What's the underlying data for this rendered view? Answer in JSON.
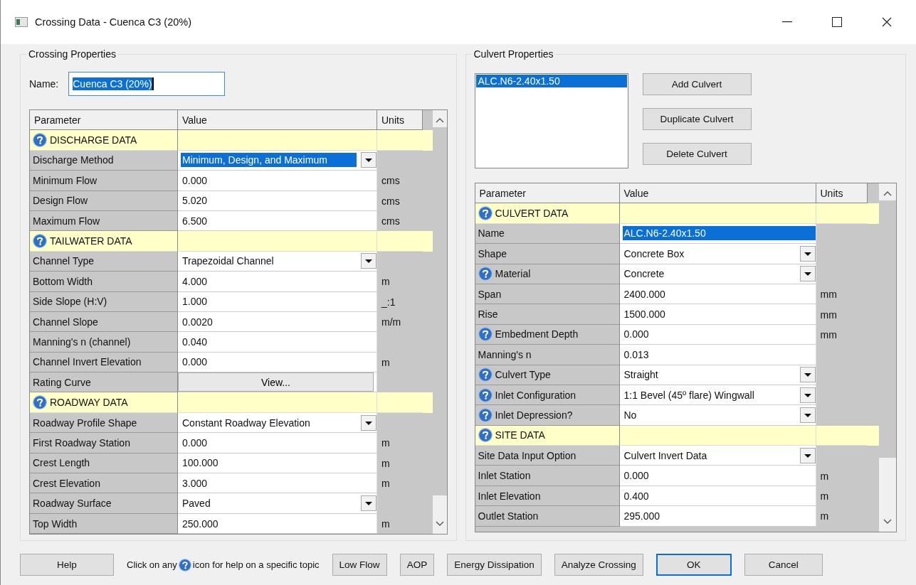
{
  "window": {
    "title": "Crossing Data - Cuenca C3 (20%)"
  },
  "crossing_properties": {
    "title": "Crossing Properties",
    "name_label": "Name:",
    "name_value": "Cuenca C3 (20%)",
    "table": {
      "columns": [
        "Parameter",
        "Value",
        "Units"
      ],
      "rows": [
        {
          "kind": "section",
          "parameter": "DISCHARGE DATA",
          "help": true
        },
        {
          "kind": "dropdown",
          "parameter": "Discharge Method",
          "value": "Minimum, Design, and Maximum",
          "help": false,
          "selected": true
        },
        {
          "kind": "text",
          "parameter": "Minimum Flow",
          "value": "0.000",
          "units": "cms",
          "help": false,
          "selected": false
        },
        {
          "kind": "text",
          "parameter": "Design Flow",
          "value": "5.020",
          "units": "cms",
          "help": false,
          "selected": false
        },
        {
          "kind": "text",
          "parameter": "Maximum Flow",
          "value": "6.500",
          "units": "cms",
          "help": false,
          "selected": false
        },
        {
          "kind": "section",
          "parameter": "TAILWATER DATA",
          "help": true
        },
        {
          "kind": "dropdown",
          "parameter": "Channel Type",
          "value": "Trapezoidal Channel",
          "help": false,
          "selected": false
        },
        {
          "kind": "text",
          "parameter": "Bottom Width",
          "value": "4.000",
          "units": "m",
          "help": false,
          "selected": false
        },
        {
          "kind": "text",
          "parameter": "Side Slope (H:V)",
          "value": "1.000",
          "units": "_:1",
          "help": false,
          "selected": false
        },
        {
          "kind": "text",
          "parameter": "Channel Slope",
          "value": "0.0020",
          "units": "m/m",
          "help": false,
          "selected": false
        },
        {
          "kind": "text",
          "parameter": "Manning's n (channel)",
          "value": "0.040",
          "help": false,
          "selected": false
        },
        {
          "kind": "text",
          "parameter": "Channel Invert Elevation",
          "value": "0.000",
          "units": "m",
          "help": false,
          "selected": false
        },
        {
          "kind": "button",
          "parameter": "Rating Curve",
          "value": "View...",
          "help": false,
          "selected": false
        },
        {
          "kind": "section",
          "parameter": "ROADWAY DATA",
          "help": true
        },
        {
          "kind": "dropdown",
          "parameter": "Roadway Profile Shape",
          "value": "Constant Roadway Elevation",
          "help": false,
          "selected": false
        },
        {
          "kind": "text",
          "parameter": "First Roadway Station",
          "value": "0.000",
          "units": "m",
          "help": false,
          "selected": false
        },
        {
          "kind": "text",
          "parameter": "Crest Length",
          "value": "100.000",
          "units": "m",
          "help": false,
          "selected": false
        },
        {
          "kind": "text",
          "parameter": "Crest Elevation",
          "value": "3.000",
          "units": "m",
          "help": false,
          "selected": false
        },
        {
          "kind": "dropdown",
          "parameter": "Roadway Surface",
          "value": "Paved",
          "help": false,
          "selected": false
        },
        {
          "kind": "text",
          "parameter": "Top Width",
          "value": "250.000",
          "units": "m",
          "help": false,
          "selected": false
        }
      ]
    }
  },
  "culvert_properties": {
    "title": "Culvert Properties",
    "culverts": [
      {
        "label": "ALC.N6-2.40x1.50",
        "selected": true
      }
    ],
    "buttons": [
      "Add Culvert",
      "Duplicate Culvert",
      "Delete Culvert"
    ],
    "table": {
      "columns": [
        "Parameter",
        "Value",
        "Units"
      ],
      "rows": [
        {
          "kind": "section",
          "parameter": "CULVERT DATA",
          "help": true
        },
        {
          "kind": "text",
          "parameter": "Name",
          "value": "ALC.N6-2.40x1.50",
          "help": false,
          "selected": true
        },
        {
          "kind": "dropdown",
          "parameter": "Shape",
          "value": "Concrete Box",
          "help": false,
          "selected": false
        },
        {
          "kind": "dropdown",
          "parameter": "Material",
          "value": "Concrete",
          "help": true,
          "selected": false
        },
        {
          "kind": "text",
          "parameter": "Span",
          "value": "2400.000",
          "units": "mm",
          "help": false,
          "selected": false
        },
        {
          "kind": "text",
          "parameter": "Rise",
          "value": "1500.000",
          "units": "mm",
          "help": false,
          "selected": false
        },
        {
          "kind": "text",
          "parameter": "Embedment Depth",
          "value": "0.000",
          "units": "mm",
          "help": true,
          "selected": false
        },
        {
          "kind": "text",
          "parameter": "Manning's n",
          "value": "0.013",
          "help": false,
          "selected": false
        },
        {
          "kind": "dropdown",
          "parameter": "Culvert Type",
          "value": "Straight",
          "help": true,
          "selected": false
        },
        {
          "kind": "dropdown",
          "parameter": "Inlet Configuration",
          "value": "1:1 Bevel (45º flare) Wingwall",
          "help": true,
          "selected": false
        },
        {
          "kind": "dropdown",
          "parameter": "Inlet Depression?",
          "value": "No",
          "help": true,
          "selected": false
        },
        {
          "kind": "section",
          "parameter": "SITE DATA",
          "help": true
        },
        {
          "kind": "dropdown",
          "parameter": "Site Data Input Option",
          "value": "Culvert Invert Data",
          "help": false,
          "selected": false
        },
        {
          "kind": "text",
          "parameter": "Inlet Station",
          "value": "0.000",
          "units": "m",
          "help": false,
          "selected": false
        },
        {
          "kind": "text",
          "parameter": "Inlet Elevation",
          "value": "0.400",
          "units": "m",
          "help": false,
          "selected": false
        },
        {
          "kind": "text",
          "parameter": "Outlet Station",
          "value": "295.000",
          "units": "m",
          "help": false,
          "selected": false
        }
      ]
    }
  },
  "footer": {
    "help_button": "Help",
    "hint_before": "Click on any",
    "hint_after": "icon for help on a specific topic",
    "buttons": [
      {
        "label": "Low Flow",
        "default": false
      },
      {
        "label": "AOP",
        "default": false
      },
      {
        "label": "Energy Dissipation",
        "default": false
      },
      {
        "label": "Analyze Crossing",
        "default": false
      },
      {
        "label": "OK",
        "default": true
      },
      {
        "label": "Cancel",
        "default": false
      }
    ]
  }
}
